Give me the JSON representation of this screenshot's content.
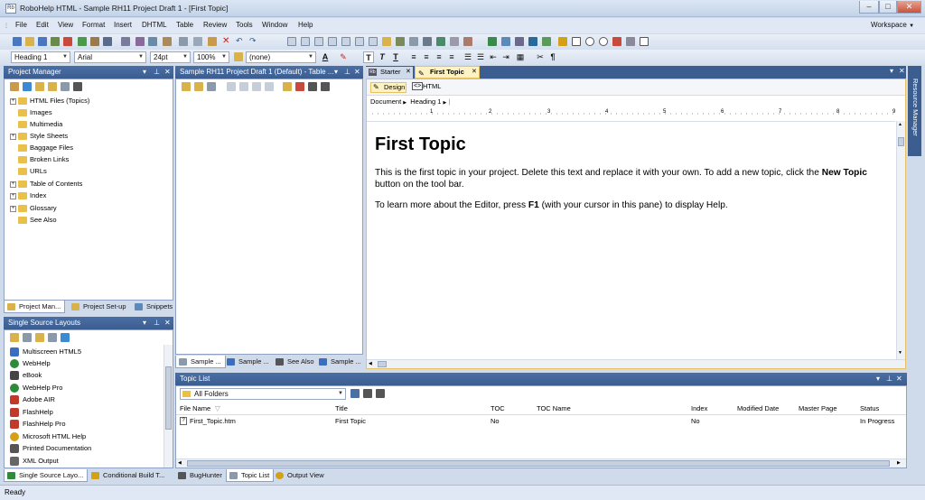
{
  "window": {
    "title": "RoboHelp HTML - Sample RH11 Project Draft 1 - [First Topic]",
    "app_icon": "Rb",
    "controls": {
      "minimize": "‒",
      "maximize": "□",
      "close": "✕"
    }
  },
  "menubar": {
    "items": [
      "File",
      "Edit",
      "View",
      "Format",
      "Insert",
      "DHTML",
      "Table",
      "Review",
      "Tools",
      "Window",
      "Help"
    ],
    "workspace": "Workspace"
  },
  "format_toolbar": {
    "style": "Heading 1",
    "font": "Arial",
    "size": "24pt",
    "zoom": "100%",
    "css_class": "(none)",
    "bold": "T",
    "italic": "T",
    "underline": "T"
  },
  "project_manager": {
    "title": "Project Manager",
    "tree": [
      {
        "label": "HTML Files (Topics)",
        "expandable": true,
        "color": "#e8c04a"
      },
      {
        "label": "Images",
        "expandable": false,
        "color": "#e8c04a"
      },
      {
        "label": "Multimedia",
        "expandable": false,
        "color": "#e8c04a"
      },
      {
        "label": "Style Sheets",
        "expandable": true,
        "color": "#e8c04a"
      },
      {
        "label": "Baggage Files",
        "expandable": false,
        "color": "#e8c04a"
      },
      {
        "label": "Broken Links",
        "expandable": false,
        "color": "#e8c04a"
      },
      {
        "label": "URLs",
        "expandable": false,
        "color": "#e8c04a"
      },
      {
        "label": "Table of Contents",
        "expandable": true,
        "color": "#e8c04a"
      },
      {
        "label": "Index",
        "expandable": true,
        "color": "#e8c04a"
      },
      {
        "label": "Glossary",
        "expandable": true,
        "color": "#e8c04a"
      },
      {
        "label": "See Also",
        "expandable": false,
        "color": "#e8c04a"
      }
    ],
    "tabs": [
      "Project Man...",
      "Project Set-up",
      "Snippets"
    ]
  },
  "toc_panel": {
    "title": "Sample RH11 Project Draft 1 (Default) - Table ...",
    "tabs": [
      "Sample ...",
      "Sample ...",
      "See Also",
      "Sample ..."
    ]
  },
  "ssl_panel": {
    "title": "Single Source Layouts",
    "items": [
      {
        "label": "Multiscreen HTML5",
        "color": "#3a6fc0"
      },
      {
        "label": "WebHelp",
        "color": "#2e8b3a"
      },
      {
        "label": "eBook",
        "color": "#444"
      },
      {
        "label": "WebHelp Pro",
        "color": "#2e8b3a"
      },
      {
        "label": "Adobe AIR",
        "color": "#c0392b"
      },
      {
        "label": "FlashHelp",
        "color": "#c0392b"
      },
      {
        "label": "FlashHelp Pro",
        "color": "#c0392b"
      },
      {
        "label": "Microsoft HTML Help",
        "color": "#d4a017"
      },
      {
        "label": "Printed Documentation",
        "color": "#555"
      },
      {
        "label": "XML Output",
        "color": "#666"
      }
    ],
    "tabs": [
      "Single Source Layo...",
      "Conditional Build T..."
    ]
  },
  "document": {
    "tabs": [
      "Starter",
      "First Topic"
    ],
    "view_buttons": [
      "Design",
      "HTML"
    ],
    "breadcrumb": [
      "Document",
      "Heading 1"
    ],
    "ruler": [
      "1",
      "2",
      "3",
      "4",
      "5",
      "6",
      "7",
      "8",
      "9"
    ],
    "heading": "First Topic",
    "p1_before": "This is the first topic in your project. Delete this text and replace it with your own. To add a new topic, click the ",
    "p1_bold": "New Topic",
    "p1_after": " button on the tool bar.",
    "p2_before": "To learn more about the Editor, press ",
    "p2_bold": "F1",
    "p2_after": " (with your cursor in this pane) to display Help."
  },
  "resource_manager": {
    "label": "Resource Manager"
  },
  "topic_list": {
    "title": "Topic List",
    "folder": "All Folders",
    "columns": [
      "File Name",
      "Title",
      "TOC",
      "TOC Name",
      "Index",
      "Modified Date",
      "Master Page",
      "Status"
    ],
    "rows": [
      {
        "file": "First_Topic.htm",
        "title": "First Topic",
        "toc": "No",
        "toc_name": "",
        "index": "No",
        "modified": "",
        "master": "",
        "status": "In Progress"
      }
    ]
  },
  "bottom_tabs": [
    "BugHunter",
    "Topic List",
    "Output View"
  ],
  "status": {
    "text": "Ready"
  }
}
